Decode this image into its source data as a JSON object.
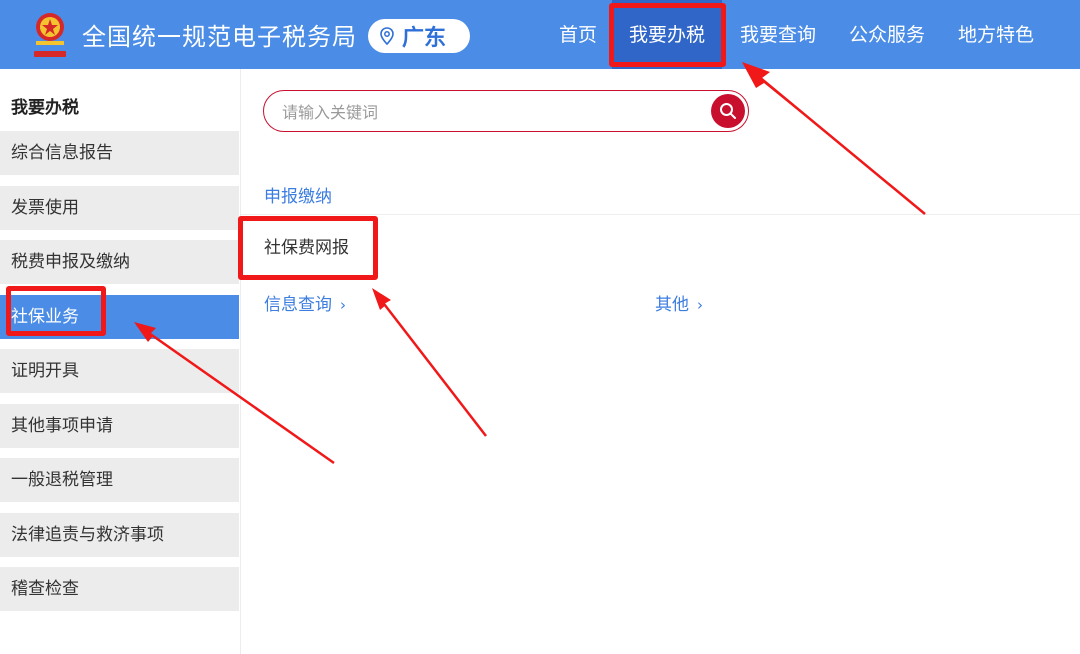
{
  "header": {
    "site_title": "全国统一规范电子税务局",
    "region": "广东",
    "nav": [
      "首页",
      "我要办税",
      "我要查询",
      "公众服务",
      "地方特色"
    ],
    "active_nav": "我要办税"
  },
  "sidebar": {
    "title": "我要办税",
    "items": [
      "综合信息报告",
      "发票使用",
      "税费申报及缴纳",
      "社保业务",
      "证明开具",
      "其他事项申请",
      "一般退税管理",
      "法律追责与救济事项",
      "稽查检查"
    ],
    "active_item": "社保业务"
  },
  "search": {
    "placeholder": "请输入关键词"
  },
  "main": {
    "section_title": "申报缴纳",
    "service": "社保费网报",
    "categories": [
      "信息查询",
      "其他"
    ]
  },
  "colors": {
    "header_bg": "#4a8ce6",
    "nav_active": "#2f66c8",
    "sidebar_active": "#4a8ce6",
    "search_accent": "#c8102e",
    "link": "#3c7de0",
    "annotation": "#f01818"
  },
  "icons": {
    "emblem": "tax-emblem-icon",
    "region": "location-pin-icon",
    "search": "search-icon",
    "category": "chevron-right-icon"
  }
}
